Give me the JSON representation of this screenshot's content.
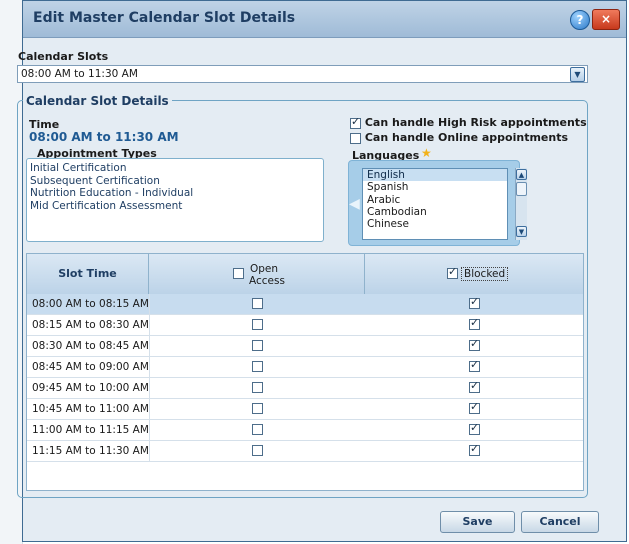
{
  "window": {
    "title": "Edit Master Calendar Slot Details",
    "help_icon": "?",
    "close_icon": "×"
  },
  "calendar_slots": {
    "label": "Calendar Slots",
    "selected": "08:00 AM to 11:30 AM"
  },
  "details": {
    "legend": "Calendar Slot Details",
    "time_label": "Time",
    "time_value": "08:00 AM to 11:30 AM",
    "appointment_types_label": "Appointment Types",
    "appointment_types": [
      "Initial Certification",
      "Subsequent Certification",
      "Nutrition Education - Individual",
      "Mid Certification Assessment"
    ],
    "high_risk": {
      "label": "Can handle High Risk appointments",
      "checked": true
    },
    "online": {
      "label": "Can handle Online appointments",
      "checked": false
    },
    "languages_label": "Languages",
    "languages": [
      "English",
      "Spanish",
      "Arabic",
      "Cambodian",
      "Chinese"
    ],
    "selected_language": "English"
  },
  "grid": {
    "col_slot_time": "Slot Time",
    "col_open_access": "Open Access",
    "col_blocked": "Blocked",
    "header_open_checked": false,
    "header_blocked_checked": true,
    "rows": [
      {
        "time": "08:00 AM to 08:15 AM",
        "open": false,
        "blocked": true,
        "selected": true
      },
      {
        "time": "08:15 AM to 08:30 AM",
        "open": false,
        "blocked": true
      },
      {
        "time": "08:30 AM to 08:45 AM",
        "open": false,
        "blocked": true
      },
      {
        "time": "08:45 AM to 09:00 AM",
        "open": false,
        "blocked": true
      },
      {
        "time": "09:45 AM to 10:00 AM",
        "open": false,
        "blocked": true
      },
      {
        "time": "10:45 AM to 11:00 AM",
        "open": false,
        "blocked": true
      },
      {
        "time": "11:00 AM to 11:15 AM",
        "open": false,
        "blocked": true
      },
      {
        "time": "11:15 AM to 11:30 AM",
        "open": false,
        "blocked": true
      }
    ]
  },
  "buttons": {
    "save": "Save",
    "cancel": "Cancel"
  }
}
